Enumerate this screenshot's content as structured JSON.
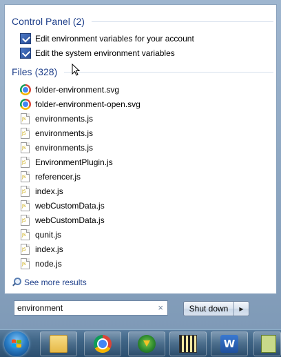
{
  "control_panel_group": {
    "title": "Control Panel",
    "count": "(2)",
    "items": [
      {
        "label": "Edit environment variables for your account",
        "icon": "control-panel-icon"
      },
      {
        "label": "Edit the system environment variables",
        "icon": "control-panel-icon"
      }
    ]
  },
  "files_group": {
    "title": "Files",
    "count": "(328)",
    "items": [
      {
        "label": "folder-environment.svg",
        "icon": "chrome-icon"
      },
      {
        "label": "folder-environment-open.svg",
        "icon": "chrome-icon"
      },
      {
        "label": "environments.js",
        "icon": "js-file-icon"
      },
      {
        "label": "environments.js",
        "icon": "js-file-icon"
      },
      {
        "label": "environments.js",
        "icon": "js-file-icon"
      },
      {
        "label": "EnvironmentPlugin.js",
        "icon": "js-file-icon"
      },
      {
        "label": "referencer.js",
        "icon": "js-file-icon"
      },
      {
        "label": "index.js",
        "icon": "js-file-icon"
      },
      {
        "label": "webCustomData.js",
        "icon": "js-file-icon"
      },
      {
        "label": "webCustomData.js",
        "icon": "js-file-icon"
      },
      {
        "label": "qunit.js",
        "icon": "js-file-icon"
      },
      {
        "label": "index.js",
        "icon": "js-file-icon"
      },
      {
        "label": "node.js",
        "icon": "js-file-icon"
      }
    ]
  },
  "see_more": {
    "label": "See more results",
    "icon": "search-icon"
  },
  "search": {
    "value": "environment",
    "clear_icon": "×"
  },
  "shutdown": {
    "label": "Shut down",
    "arrow": "▶"
  },
  "taskbar": {
    "items": [
      {
        "name": "start-button",
        "icon": "windows-logo-icon"
      },
      {
        "name": "explorer",
        "icon": "folder-icon"
      },
      {
        "name": "chrome",
        "icon": "chrome-icon"
      },
      {
        "name": "download-manager",
        "icon": "download-manager-icon"
      },
      {
        "name": "media-player",
        "icon": "media-player-icon"
      },
      {
        "name": "word",
        "icon": "word-icon",
        "glyph": "W"
      },
      {
        "name": "app",
        "icon": "app-icon"
      }
    ]
  }
}
